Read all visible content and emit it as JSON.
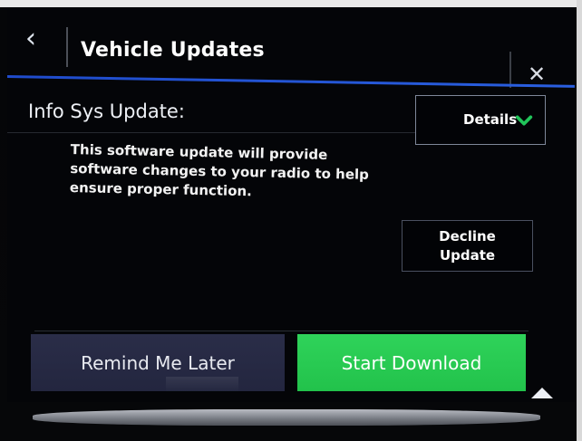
{
  "header": {
    "back_icon": "chevron-left-icon",
    "title": "Vehicle Updates",
    "close_icon": "close-icon"
  },
  "update": {
    "label": "Info Sys Update:",
    "details_label": "Details",
    "details_icon": "chevron-down-icon",
    "description": "This software update will provide software changes to your radio to help ensure proper function."
  },
  "decline": {
    "label_line1": "Decline",
    "label_line2": "Update"
  },
  "actions": {
    "remind_label": "Remind Me Later",
    "download_label": "Start Download"
  },
  "scroll": {
    "icon": "up-arrow-icon"
  },
  "colors": {
    "accent_blue": "#2a5fe0",
    "download_green": "#22c24b",
    "remind_bg": "#23263f",
    "details_check": "#21c45a"
  }
}
